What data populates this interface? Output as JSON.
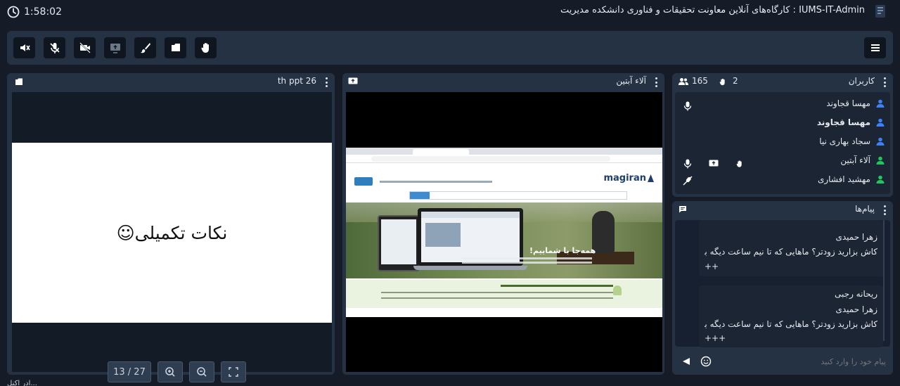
{
  "header": {
    "timer": "1:58:02",
    "title": "IUMS-IT-Admin : کارگاه‌های آنلاین معاونت تحقیقات و فناوری دانشکده مدیریت"
  },
  "toolbar": {
    "buttons": [
      "speaker-mute-icon",
      "mic-mute-icon",
      "camera-off-icon",
      "screen-share-icon",
      "brush-icon",
      "folder-icon",
      "hand-icon"
    ],
    "menu": "menu-icon"
  },
  "left_panel": {
    "title": "th ppt 26",
    "slide_text": "نکات تکمیلی☺",
    "page": "13 / 27"
  },
  "mid_panel": {
    "title": "آلاء آبتین",
    "shared_site": {
      "logo": "magiran",
      "hero": "همه‌جا با شماییم!"
    }
  },
  "users_panel": {
    "title": "کاربران",
    "count": "165",
    "hands": "2",
    "users": [
      {
        "name": "مهسا قجاوند",
        "bold": false,
        "color": "#3b82f6"
      },
      {
        "name": "مهسا قجاوند",
        "bold": true,
        "color": "#3b82f6"
      },
      {
        "name": "سجاد بهاری نیا",
        "bold": false,
        "color": "#3b82f6"
      },
      {
        "name": "آلاء آبتین",
        "bold": false,
        "color": "#22c55e"
      },
      {
        "name": "مهشید افشاری",
        "bold": false,
        "color": "#22c55e"
      }
    ]
  },
  "chat_panel": {
    "title": "پیام‌ها",
    "messages": [
      {
        "quote_author": "زهرا حمیدی",
        "quote": "کاش بزارید زودتر؟ ماهایی که تا نیم ساعت دیگه برق...",
        "reply": "++"
      },
      {
        "author": "ریحانه رجبی",
        "quote_author": "زهرا حمیدی",
        "quote": "کاش بزارید زودتر؟ ماهایی که تا نیم ساعت دیگه برق...",
        "reply": "+++"
      }
    ],
    "input_placeholder": "پیام خود را وارد کنید"
  },
  "footer": {
    "text": "ادر اکنل..."
  },
  "colors": {
    "background": "#151c28",
    "panel": "#243244",
    "accent_blue": "#3b82f6",
    "accent_green": "#22c55e"
  }
}
